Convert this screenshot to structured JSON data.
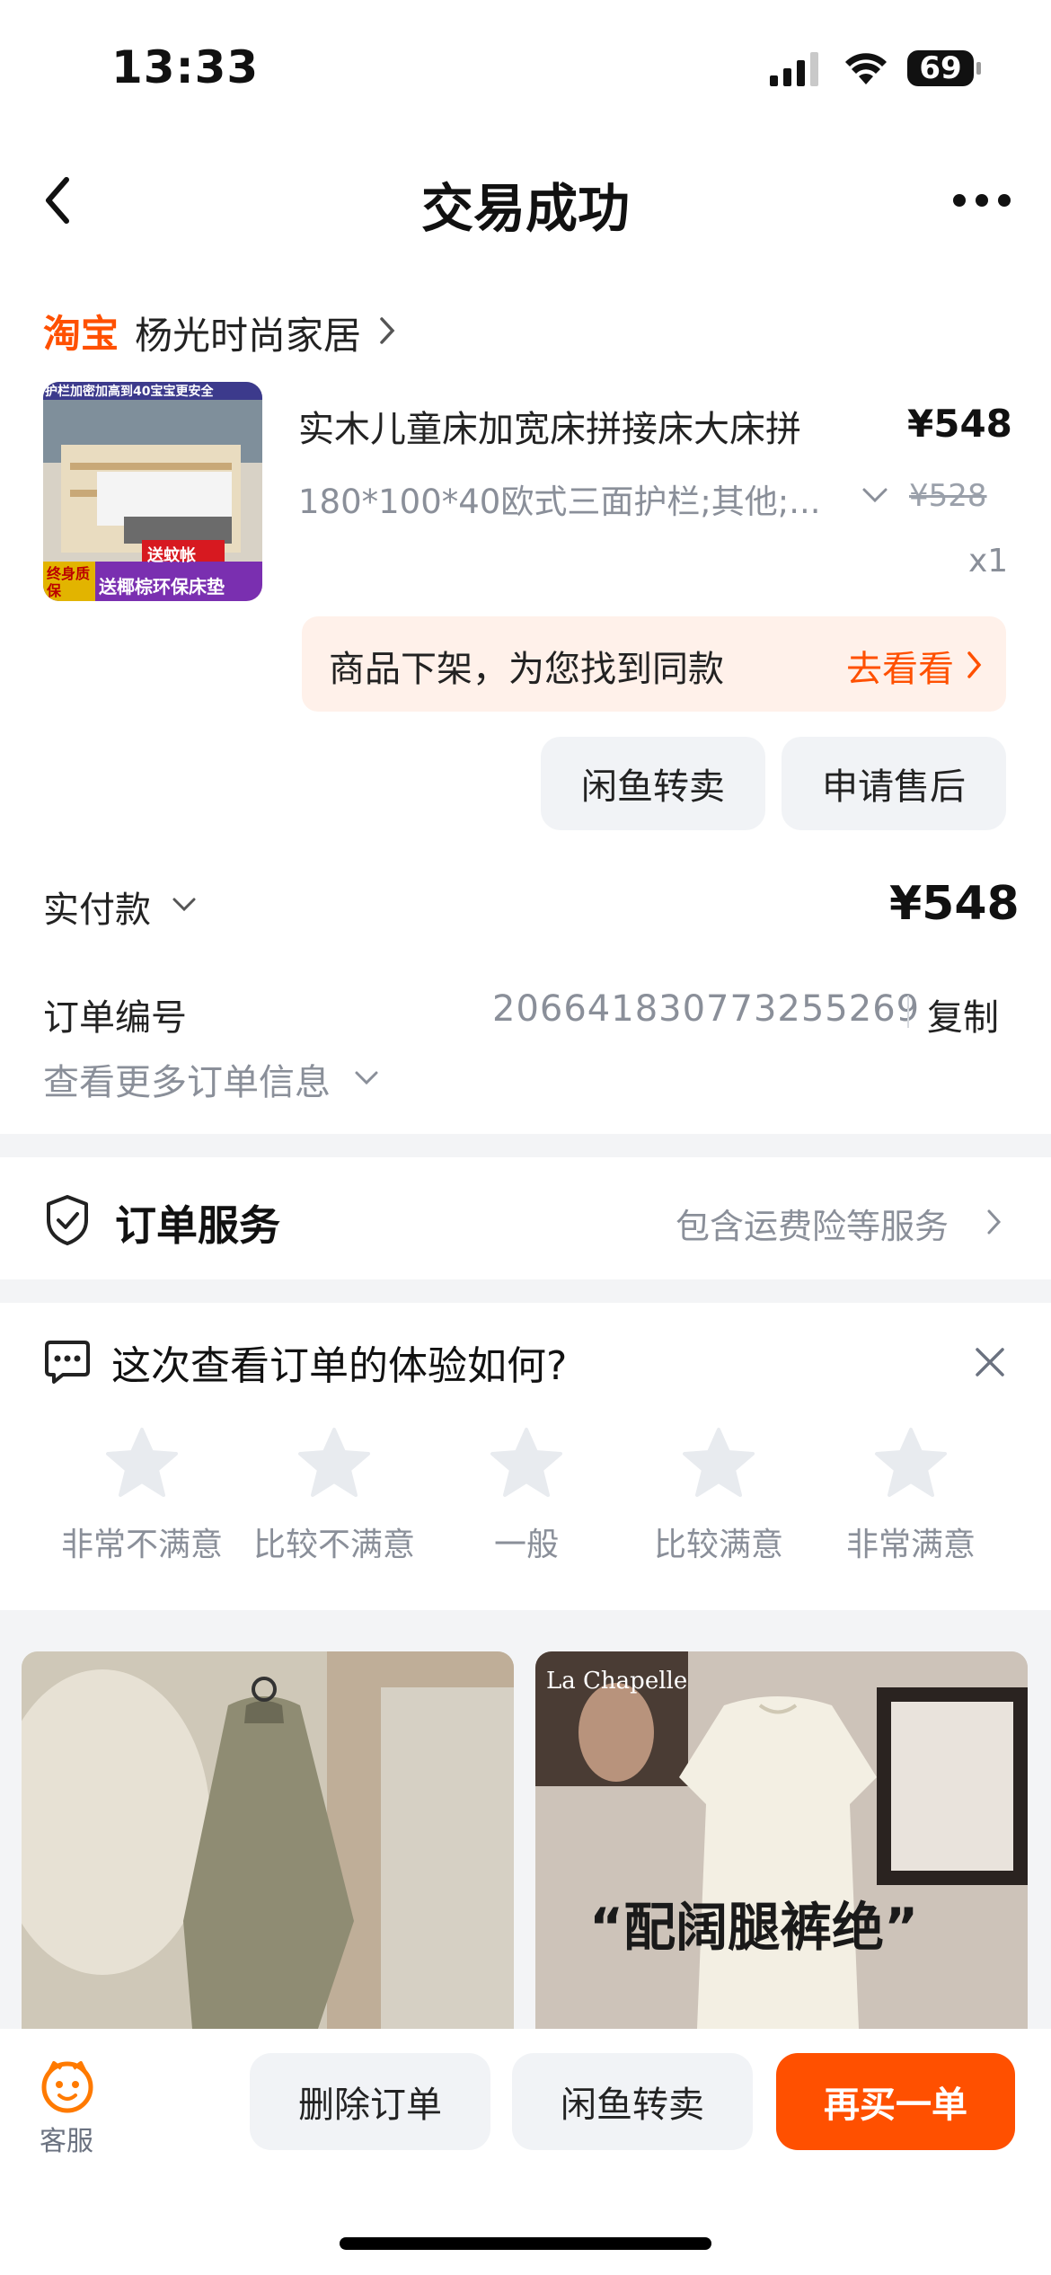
{
  "status_bar": {
    "time": "13:33",
    "battery": "69"
  },
  "nav": {
    "title": "交易成功"
  },
  "shop": {
    "brand": "淘宝",
    "name": "杨光时尚家居"
  },
  "product": {
    "title": "实木儿童床加宽床拼接床大床拼",
    "spec": "180*100*40欧式三面护栏;其他;...",
    "price": "¥548",
    "original_price": "¥528",
    "quantity": "x1",
    "image_texts": {
      "top": "护栏加密加高到40宝宝更安全",
      "badge": "送蚊帐",
      "left_badge": "终身质保",
      "bottom": "送椰棕环保床垫"
    }
  },
  "notice": {
    "text": "商品下架，为您找到同款",
    "link": "去看看"
  },
  "actions": {
    "resell": "闲鱼转卖",
    "after_sale": "申请售后"
  },
  "payment": {
    "label": "实付款",
    "amount": "¥548"
  },
  "order": {
    "label": "订单编号",
    "number": "2066418307732552​69",
    "copy": "复制",
    "more": "查看更多订单信息"
  },
  "service": {
    "title": "订单服务",
    "desc": "包含运费险等服务"
  },
  "feedback": {
    "title": "这次查看订单的体验如何?",
    "options": [
      "非常不满意",
      "比较不满意",
      "一般",
      "比较满意",
      "非常满意"
    ]
  },
  "recommendations": {
    "card2_brand": "La Chapelle",
    "card2_caption": "“配阔腿裤绝”"
  },
  "bottom_bar": {
    "customer_service": "客服",
    "delete": "删除订单",
    "resell": "闲鱼转卖",
    "rebuy": "再买一单"
  },
  "colors": {
    "accent": "#ff5000",
    "notice_bg": "#fff1ea",
    "muted_text": "#8a8f99"
  }
}
